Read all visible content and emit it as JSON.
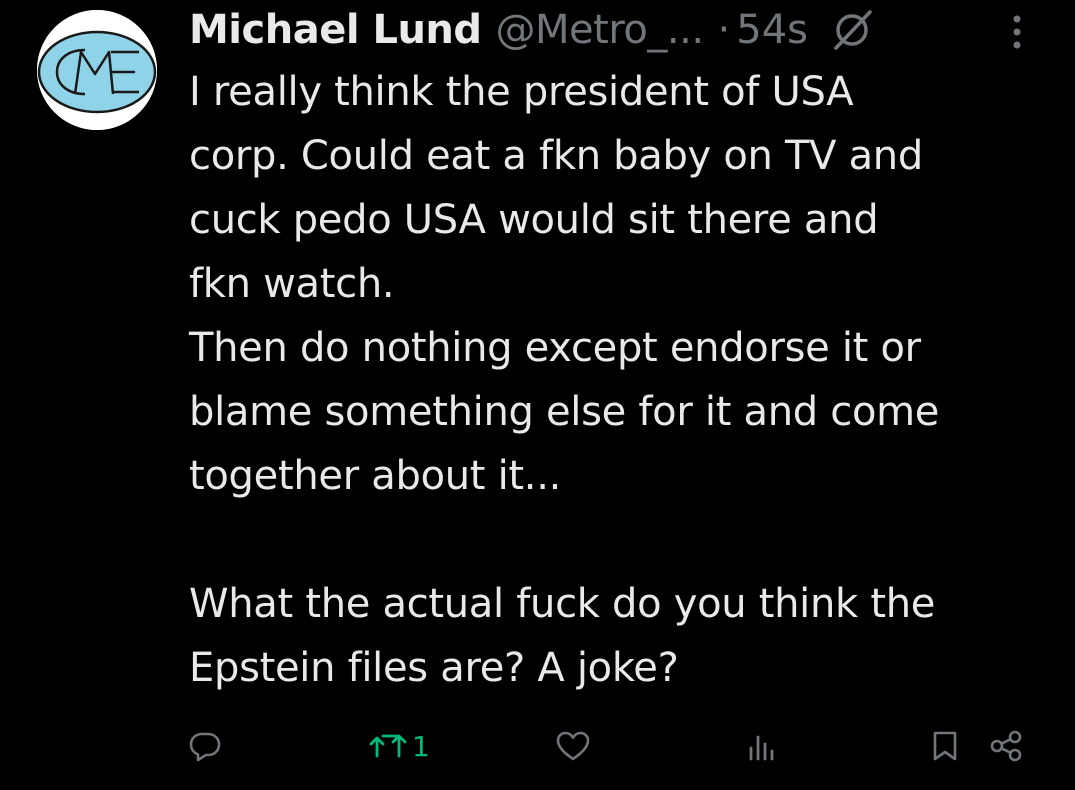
{
  "colors": {
    "background": "#000000",
    "text_primary": "#e7e9ea",
    "text_secondary": "#71767b",
    "retweet_active": "#00ba7c",
    "avatar_circle": "#8fd3e8"
  },
  "author": {
    "avatar_icon": "me-logo-avatar",
    "name": "Michael Lund",
    "handle": "@Metro_...",
    "separator": "·",
    "time": "54s",
    "badge_icon": "grok-icon"
  },
  "tweet": {
    "lines": [
      "I really think the president of USA",
      "corp. Could eat a fkn baby on TV and",
      "cuck pedo USA would sit there and",
      "fkn watch.",
      "Then do nothing except endorse it or",
      "blame something else for it and come",
      "together about it...",
      "",
      "What the actual fuck do you think the",
      "Epstein files are? A joke?"
    ]
  },
  "actions": {
    "reply_icon": "reply-icon",
    "retweet_icon": "retweet-icon",
    "retweet_count": "1",
    "like_icon": "heart-icon",
    "views_icon": "views-icon",
    "bookmark_icon": "bookmark-icon",
    "share_icon": "share-icon"
  }
}
